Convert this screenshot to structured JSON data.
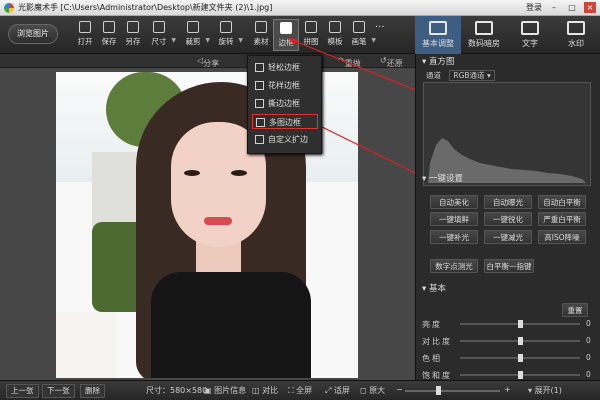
{
  "window": {
    "title": "光影魔术手 [C:\\Users\\Administrator\\Desktop\\新建文件夹 (2)\\1.jpg]",
    "login": "登录"
  },
  "toolbar": {
    "browse_label": "浏览图片",
    "tools": [
      {
        "label": "打开",
        "icon": "open-icon"
      },
      {
        "label": "保存",
        "icon": "save-icon"
      },
      {
        "label": "另存",
        "icon": "save-as-icon"
      },
      {
        "label": "尺寸",
        "icon": "resize-icon"
      },
      {
        "label": "裁剪",
        "icon": "crop-icon"
      },
      {
        "label": "旋转",
        "icon": "rotate-icon"
      },
      {
        "label": "素材",
        "icon": "material-icon"
      },
      {
        "label": "边框",
        "icon": "frame-icon"
      },
      {
        "label": "拼图",
        "icon": "collage-icon"
      },
      {
        "label": "模板",
        "icon": "template-icon"
      },
      {
        "label": "画笔",
        "icon": "brush-icon"
      }
    ],
    "more": "···"
  },
  "right_tabs": [
    {
      "label": "基本调整",
      "icon": "adjust-icon"
    },
    {
      "label": "数码暗房",
      "icon": "darkroom-icon"
    },
    {
      "label": "文字",
      "icon": "text-icon"
    },
    {
      "label": "水印",
      "icon": "watermark-icon"
    }
  ],
  "subbar": {
    "share": "分享",
    "redo": "重做",
    "restore": "还原"
  },
  "frame_menu": [
    {
      "label": "轻松边框"
    },
    {
      "label": "花样边框"
    },
    {
      "label": "撕边边框"
    },
    {
      "label": "多图边框"
    },
    {
      "label": "自定义扩边"
    }
  ],
  "panel": {
    "histogram": {
      "title": "直方图",
      "channel_label": "通道",
      "channel_value": "RGB通道"
    },
    "one_click": {
      "title": "一键设置",
      "buttons": [
        "自动美化",
        "自动曝光",
        "自动白平衡",
        "一键填鲜",
        "一键锐化",
        "严重白平衡",
        "一键补光",
        "一键减光",
        "高ISO降噪",
        "数字点测光",
        "白平衡一指键"
      ]
    },
    "basic": {
      "title": "基本",
      "reset": "重置",
      "sliders": [
        {
          "label": "亮度",
          "value": "0",
          "level": 0.5
        },
        {
          "label": "对比度",
          "value": "0",
          "level": 0.5
        },
        {
          "label": "色相",
          "value": "0",
          "level": 0.5
        },
        {
          "label": "饱和度",
          "value": "0",
          "level": 0.5
        }
      ]
    }
  },
  "statusbar": {
    "prev": "上一张",
    "next": "下一张",
    "delete": "删除",
    "size": "尺寸：580×580",
    "info": "图片信息",
    "compare": "对比",
    "fullscreen": "全屏",
    "fit": "适屏",
    "original": "原大",
    "expand": "展开(1)",
    "zoom_level": 0.35
  },
  "colors": {
    "accent": "#3d5e82",
    "highlight": "#e03030"
  }
}
